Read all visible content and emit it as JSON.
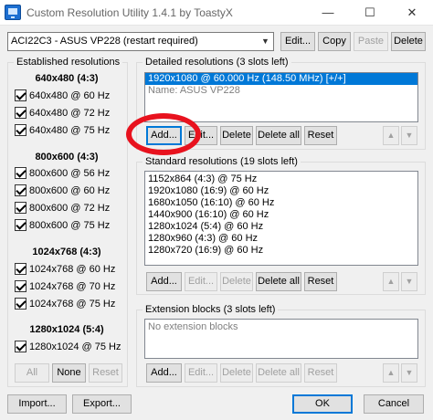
{
  "window": {
    "title": "Custom Resolution Utility 1.4.1 by ToastyX",
    "minimize": "—",
    "maximize": "☐",
    "close": "✕"
  },
  "monitor": {
    "selected": "ACI22C3 - ASUS VP228 (restart required)",
    "edit": "Edit...",
    "copy": "Copy",
    "paste": "Paste",
    "delete": "Delete"
  },
  "established": {
    "title": "Established resolutions",
    "groups": [
      {
        "header": "640x480 (4:3)",
        "items": [
          "640x480 @ 60 Hz",
          "640x480 @ 72 Hz",
          "640x480 @ 75 Hz"
        ]
      },
      {
        "header": "800x600 (4:3)",
        "items": [
          "800x600 @ 56 Hz",
          "800x600 @ 60 Hz",
          "800x600 @ 72 Hz",
          "800x600 @ 75 Hz"
        ]
      },
      {
        "header": "1024x768 (4:3)",
        "items": [
          "1024x768 @ 60 Hz",
          "1024x768 @ 70 Hz",
          "1024x768 @ 75 Hz"
        ]
      },
      {
        "header": "1280x1024 (5:4)",
        "items": [
          "1280x1024 @ 75 Hz"
        ]
      }
    ],
    "all": "All",
    "none": "None",
    "reset": "Reset"
  },
  "detailed": {
    "title": "Detailed resolutions (3 slots left)",
    "items": [
      "1920x1080 @ 60.000 Hz (148.50 MHz) [+/+]",
      "Name: ASUS VP228"
    ],
    "add": "Add...",
    "edit": "Edit...",
    "delete": "Delete",
    "delete_all": "Delete all",
    "reset": "Reset",
    "up": "▲",
    "down": "▼"
  },
  "standard": {
    "title": "Standard resolutions (19 slots left)",
    "items": [
      "1152x864 (4:3) @ 75 Hz",
      "1920x1080 (16:9) @ 60 Hz",
      "1680x1050 (16:10) @ 60 Hz",
      "1440x900 (16:10) @ 60 Hz",
      "1280x1024 (5:4) @ 60 Hz",
      "1280x960 (4:3) @ 60 Hz",
      "1280x720 (16:9) @ 60 Hz"
    ],
    "add": "Add...",
    "edit": "Edit...",
    "delete": "Delete",
    "delete_all": "Delete all",
    "reset": "Reset",
    "up": "▲",
    "down": "▼"
  },
  "extension": {
    "title": "Extension blocks (3 slots left)",
    "items": [
      "No extension blocks"
    ],
    "add": "Add...",
    "edit": "Edit...",
    "delete": "Delete",
    "delete_all": "Delete all",
    "reset": "Reset",
    "up": "▲",
    "down": "▼"
  },
  "footer": {
    "import": "Import...",
    "export": "Export...",
    "ok": "OK",
    "cancel": "Cancel"
  },
  "colors": {
    "selection": "#0078d7",
    "highlight_ring": "#e8121e"
  }
}
